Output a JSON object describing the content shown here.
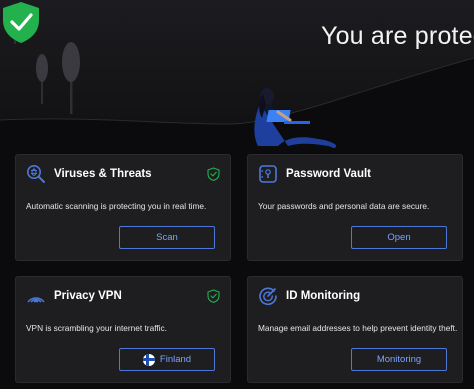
{
  "header": {
    "title": "You are protected"
  },
  "cards": [
    {
      "title": "Viruses & Threats",
      "icon": "virus-scan-icon",
      "desc": "Automatic scanning is protecting you in real time.",
      "button": "Scan",
      "checked": true
    },
    {
      "title": "Password Vault",
      "icon": "vault-icon",
      "desc": "Your passwords and personal data are secure.",
      "button": "Open",
      "checked": false
    },
    {
      "title": "Privacy VPN",
      "icon": "vpn-signal-icon",
      "desc": "VPN is scrambling your internet traffic.",
      "button": "Finland",
      "button_icon": "finland-flag-icon",
      "checked": true
    },
    {
      "title": "ID Monitoring",
      "icon": "id-monitoring-icon",
      "desc": "Manage email addresses to help prevent identity theft.",
      "button": "Monitoring",
      "checked": false
    }
  ],
  "colors": {
    "accent": "#4d78d8",
    "success": "#22b14c",
    "card_bg": "#1e1e21",
    "bg": "#0b0b0d"
  }
}
